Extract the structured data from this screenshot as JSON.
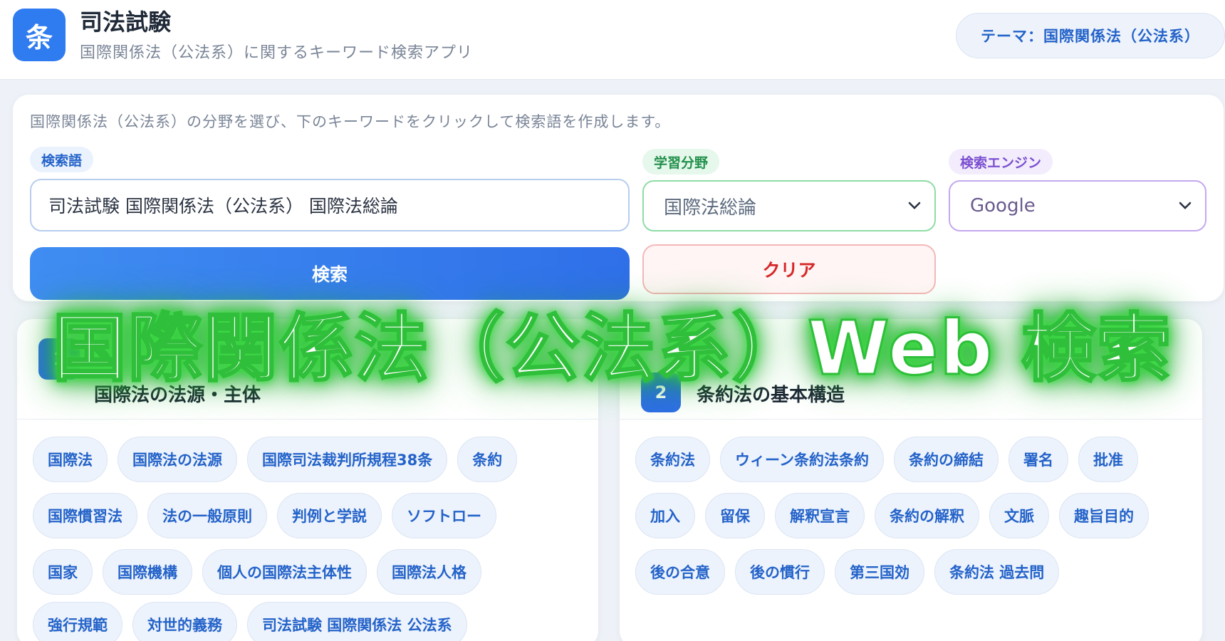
{
  "header": {
    "logo_char": "条",
    "title": "司法試験",
    "subtitle": "国際関係法（公法系）に関するキーワード検索アプリ",
    "theme": "テーマ：国際関係法（公法系）"
  },
  "search": {
    "instruction": "国際関係法（公法系）の分野を選び、下のキーワードをクリックして検索語を作成します。",
    "query_label": "検索語",
    "query_value": "司法試験 国際関係法（公法系） 国際法総論",
    "field_label": "学習分野",
    "field_value": "国際法総論",
    "engine_label": "検索エンジン",
    "engine_value": "Google",
    "search_button": "検索",
    "clear_button": "クリア"
  },
  "categories": [
    {
      "number": "1",
      "title": "国際法の法源・主体",
      "tags": [
        [
          "国際法",
          "国際法の法源",
          "国際司法裁判所規程38条",
          "条約"
        ],
        [
          "国際慣習法",
          "法の一般原則",
          "判例と学説",
          "ソフトロー"
        ],
        [
          "国家",
          "国際機構",
          "個人の国際法主体性",
          "国際法人格"
        ],
        [
          "強行規範",
          "対世的義務",
          "司法試験 国際関係法 公法系"
        ]
      ]
    },
    {
      "number": "2",
      "title": "条約法の基本構造",
      "tags": [
        [
          "条約法",
          "ウィーン条約法条約",
          "条約の締結",
          "署名",
          "批准"
        ],
        [
          "加入",
          "留保",
          "解釈宣言",
          "条約の解釈",
          "文脈",
          "趣旨目的"
        ],
        [
          "後の合意",
          "後の慣行",
          "第三国効",
          "条約法 過去問"
        ]
      ]
    }
  ],
  "overlay_title": "国際関係法（公法系）Web 検索",
  "colors": {
    "accent": "#2f6fe8",
    "tag_text": "#2463c9",
    "clear_text": "#d62828",
    "field_border": "#8fdca6",
    "engine_border": "#c4a8ee",
    "overlay_glow": "#2fbf3a"
  }
}
